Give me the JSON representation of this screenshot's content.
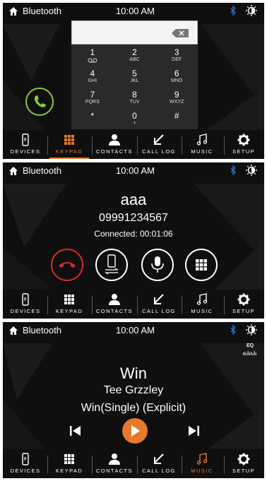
{
  "status_bar": {
    "title": "Bluetooth",
    "time": "10:00 AM"
  },
  "nav": {
    "devices": "DEVICES",
    "keypad": "KEYPAD",
    "contacts": "CONTACTS",
    "call_log": "CALL LOG",
    "music": "MUSIC",
    "setup": "SETUP"
  },
  "keypad": {
    "keys": [
      {
        "digit": "1",
        "letters": "voicemail-icon"
      },
      {
        "digit": "2",
        "letters": "ABC"
      },
      {
        "digit": "3",
        "letters": "DEF"
      },
      {
        "digit": "4",
        "letters": "GHI"
      },
      {
        "digit": "5",
        "letters": "JKL"
      },
      {
        "digit": "6",
        "letters": "MNO"
      },
      {
        "digit": "7",
        "letters": "PQRS"
      },
      {
        "digit": "8",
        "letters": "TUV"
      },
      {
        "digit": "9",
        "letters": "WXYZ"
      },
      {
        "digit": "*",
        "letters": ""
      },
      {
        "digit": "0",
        "letters": "+"
      },
      {
        "digit": "#",
        "letters": ""
      }
    ]
  },
  "call": {
    "name": "aaa",
    "number": "09991234567",
    "status": "Connected: 00:01:06"
  },
  "music": {
    "eq_label": "EQ",
    "title": "Win",
    "artist": "Tee Grzzley",
    "album": "Win(Single) (Explicit)"
  },
  "colors": {
    "accent": "#e77a2c",
    "bluetooth": "#2f6fd8",
    "call_green": "#8cc63f",
    "end_red": "#d52b2b"
  }
}
